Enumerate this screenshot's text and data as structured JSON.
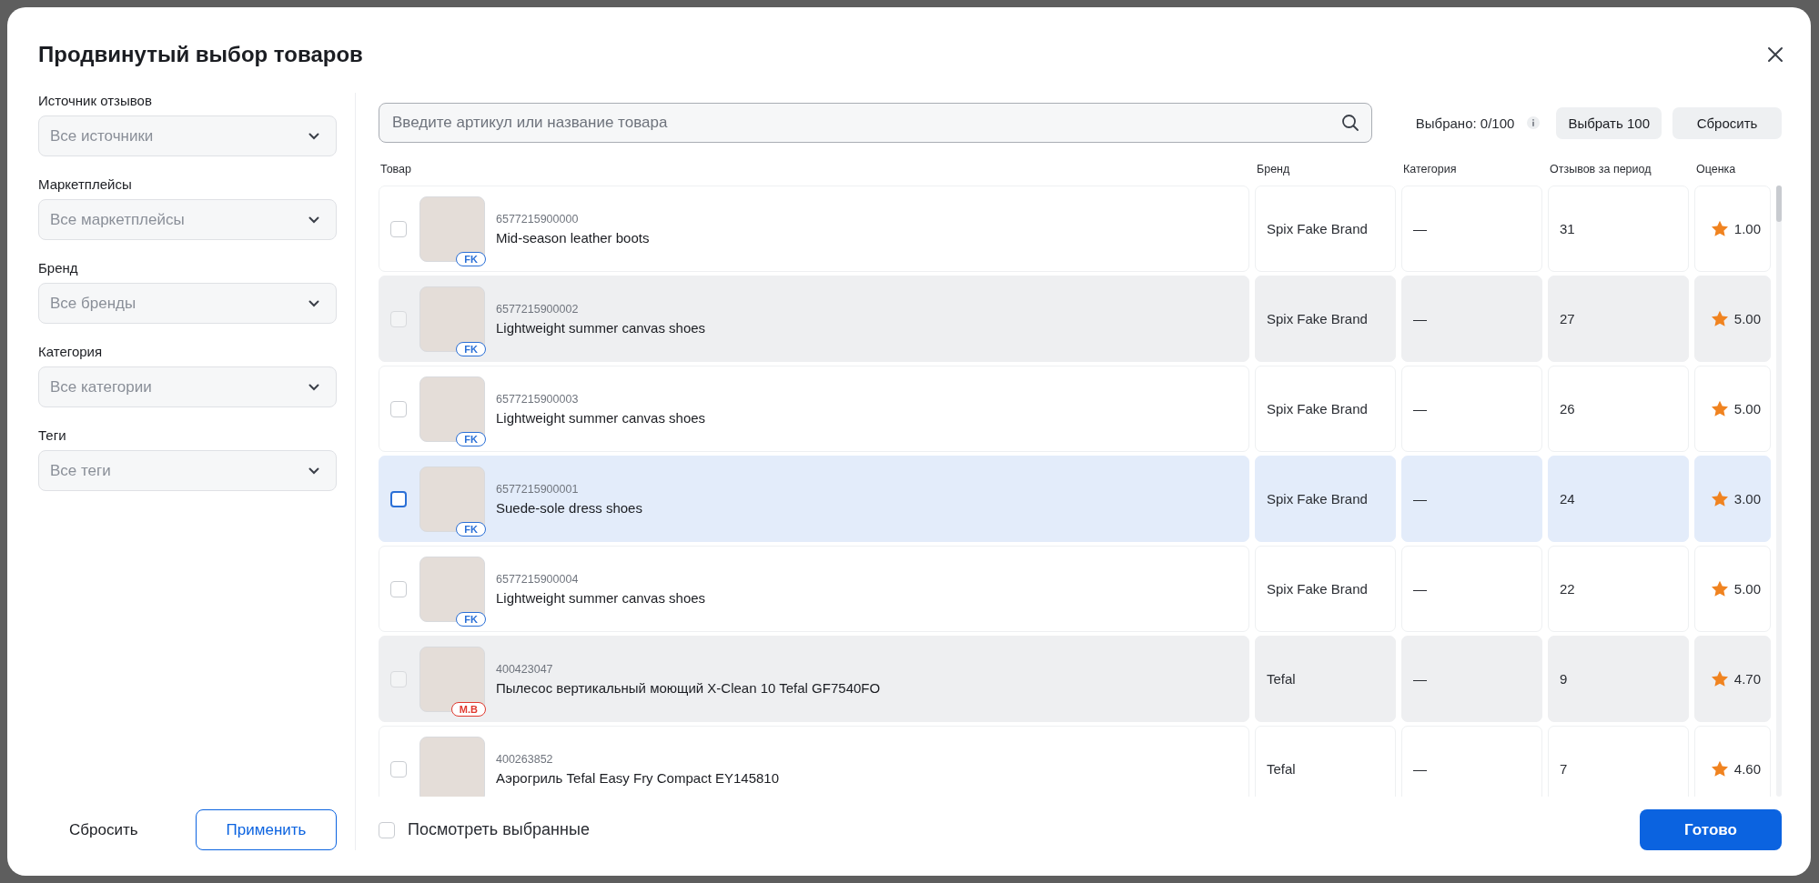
{
  "window": {
    "title": "Продвинутый выбор товаров"
  },
  "filters": [
    {
      "label": "Источник отзывов",
      "placeholder": "Все источники"
    },
    {
      "label": "Маркетплейсы",
      "placeholder": "Все маркетплейсы"
    },
    {
      "label": "Бренд",
      "placeholder": "Все бренды"
    },
    {
      "label": "Категория",
      "placeholder": "Все категории"
    },
    {
      "label": "Теги",
      "placeholder": "Все теги"
    }
  ],
  "filter_buttons": {
    "reset": "Сбросить",
    "apply": "Применить"
  },
  "search": {
    "placeholder": "Введите артикул или название товара"
  },
  "selection": {
    "counter": "Выбрано: 0/100",
    "select_all": "Выбрать 100",
    "reset": "Сбросить"
  },
  "table": {
    "columns": [
      "Товар",
      "Бренд",
      "Категория",
      "Отзывов за период",
      "Оценка"
    ],
    "rows": [
      {
        "sku": "6577215900000",
        "name": "Mid-season leather boots",
        "badge": {
          "text": "FK",
          "color": "#2a6fd6"
        },
        "brand": "Spix Fake Brand",
        "category": "—",
        "reviews": "31",
        "rating": "1.00",
        "checked": false,
        "highlighted": false
      },
      {
        "sku": "6577215900002",
        "name": "Lightweight summer canvas shoes",
        "badge": {
          "text": "FK",
          "color": "#2a6fd6"
        },
        "brand": "Spix Fake Brand",
        "category": "—",
        "reviews": "27",
        "rating": "5.00",
        "checked": false,
        "highlighted": false
      },
      {
        "sku": "6577215900003",
        "name": "Lightweight summer canvas shoes",
        "badge": {
          "text": "FK",
          "color": "#2a6fd6"
        },
        "brand": "Spix Fake Brand",
        "category": "—",
        "reviews": "26",
        "rating": "5.00",
        "checked": false,
        "highlighted": false
      },
      {
        "sku": "6577215900001",
        "name": "Suede-sole dress shoes",
        "badge": {
          "text": "FK",
          "color": "#2a6fd6"
        },
        "brand": "Spix Fake Brand",
        "category": "—",
        "reviews": "24",
        "rating": "3.00",
        "checked": false,
        "highlighted": true
      },
      {
        "sku": "6577215900004",
        "name": "Lightweight summer canvas shoes",
        "badge": {
          "text": "FK",
          "color": "#2a6fd6"
        },
        "brand": "Spix Fake Brand",
        "category": "—",
        "reviews": "22",
        "rating": "5.00",
        "checked": false,
        "highlighted": false
      },
      {
        "sku": "400423047",
        "name": "Пылесос вертикальный моющий X-Clean 10 Tefal GF7540FO",
        "badge": {
          "text": "M.B",
          "color": "#e0392f"
        },
        "brand": "Tefal",
        "category": "—",
        "reviews": "9",
        "rating": "4.70",
        "checked": false,
        "highlighted": false
      },
      {
        "sku": "400263852",
        "name": "Аэрогриль Tefal Easy Fry Compact EY145810",
        "brand": "Tefal",
        "category": "—",
        "reviews": "7",
        "rating": "4.60",
        "checked": false,
        "highlighted": false
      }
    ]
  },
  "footer": {
    "show_selected": {
      "label": "Посмотреть выбранные",
      "checked": false
    },
    "done": "Готово"
  }
}
